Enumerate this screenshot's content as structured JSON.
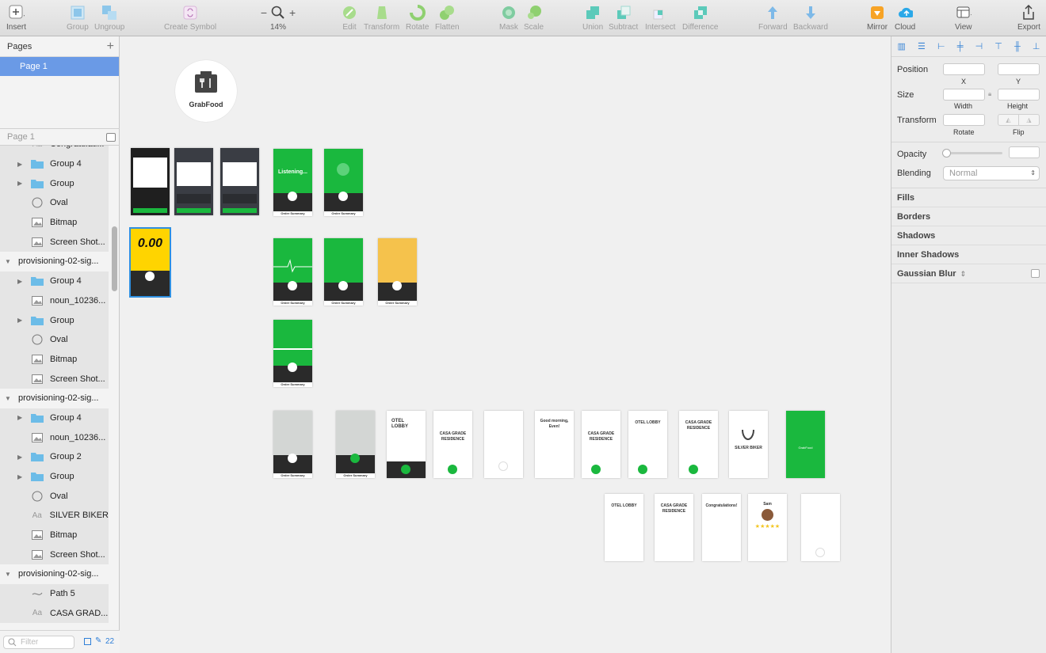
{
  "toolbar": {
    "insert": "Insert",
    "group": "Group",
    "ungroup": "Ungroup",
    "create_symbol": "Create Symbol",
    "zoom": "14%",
    "edit": "Edit",
    "transform": "Transform",
    "rotate": "Rotate",
    "flatten": "Flatten",
    "mask": "Mask",
    "scale": "Scale",
    "union": "Union",
    "subtract": "Subtract",
    "intersect": "Intersect",
    "difference": "Difference",
    "forward": "Forward",
    "backward": "Backward",
    "mirror": "Mirror",
    "cloud": "Cloud",
    "view": "View",
    "export": "Export"
  },
  "pages": {
    "title": "Pages",
    "items": [
      "Page 1"
    ],
    "current": "Page 1"
  },
  "layers": [
    {
      "label": "Congratulati...",
      "type": "text"
    },
    {
      "label": "Group 4",
      "type": "folder"
    },
    {
      "label": "Group",
      "type": "folder"
    },
    {
      "label": "Oval",
      "type": "oval"
    },
    {
      "label": "Bitmap",
      "type": "bitmap"
    },
    {
      "label": "Screen Shot...",
      "type": "bitmap"
    },
    {
      "label": "provisioning-02-sig...",
      "type": "artboard"
    },
    {
      "label": "Group 4",
      "type": "folder"
    },
    {
      "label": "noun_10236...",
      "type": "bitmap"
    },
    {
      "label": "Group",
      "type": "folder"
    },
    {
      "label": "Oval",
      "type": "oval"
    },
    {
      "label": "Bitmap",
      "type": "bitmap"
    },
    {
      "label": "Screen Shot...",
      "type": "bitmap"
    },
    {
      "label": "provisioning-02-sig...",
      "type": "artboard"
    },
    {
      "label": "Group 4",
      "type": "folder"
    },
    {
      "label": "noun_10236...",
      "type": "bitmap"
    },
    {
      "label": "Group 2",
      "type": "folder"
    },
    {
      "label": "Group",
      "type": "folder"
    },
    {
      "label": "Oval",
      "type": "oval"
    },
    {
      "label": "SILVER BIKER",
      "type": "text"
    },
    {
      "label": "Bitmap",
      "type": "bitmap"
    },
    {
      "label": "Screen Shot...",
      "type": "bitmap"
    },
    {
      "label": "provisioning-02-sig...",
      "type": "artboard"
    },
    {
      "label": "Path 5",
      "type": "path"
    },
    {
      "label": "CASA GRAD...",
      "type": "text"
    }
  ],
  "filter": {
    "placeholder": "Filter",
    "count": "22"
  },
  "canvas": {
    "logo": "GrabFood",
    "listening": "Listening...",
    "order_summary": "Order Summary",
    "counter": "0.00",
    "otel_lobby": "OTEL LOBBY",
    "casa": "CASA GRADE RESIDENCE",
    "good_morning": "Good morning, Even!",
    "silver_biker": "SILVER BIKER",
    "grabfood_small": "GrabFood",
    "congrats": "Congratulations!",
    "sam": "Sam"
  },
  "inspector": {
    "position": "Position",
    "x": "X",
    "y": "Y",
    "size": "Size",
    "width": "Width",
    "height": "Height",
    "transform": "Transform",
    "rotate": "Rotate",
    "flip": "Flip",
    "opacity": "Opacity",
    "blending": "Blending",
    "blend_value": "Normal",
    "sections": [
      "Fills",
      "Borders",
      "Shadows",
      "Inner Shadows",
      "Gaussian Blur"
    ]
  },
  "colors": {
    "brand_green": "#1ab83e",
    "selection": "#6a9ae6",
    "yellow": "#ffd400"
  }
}
